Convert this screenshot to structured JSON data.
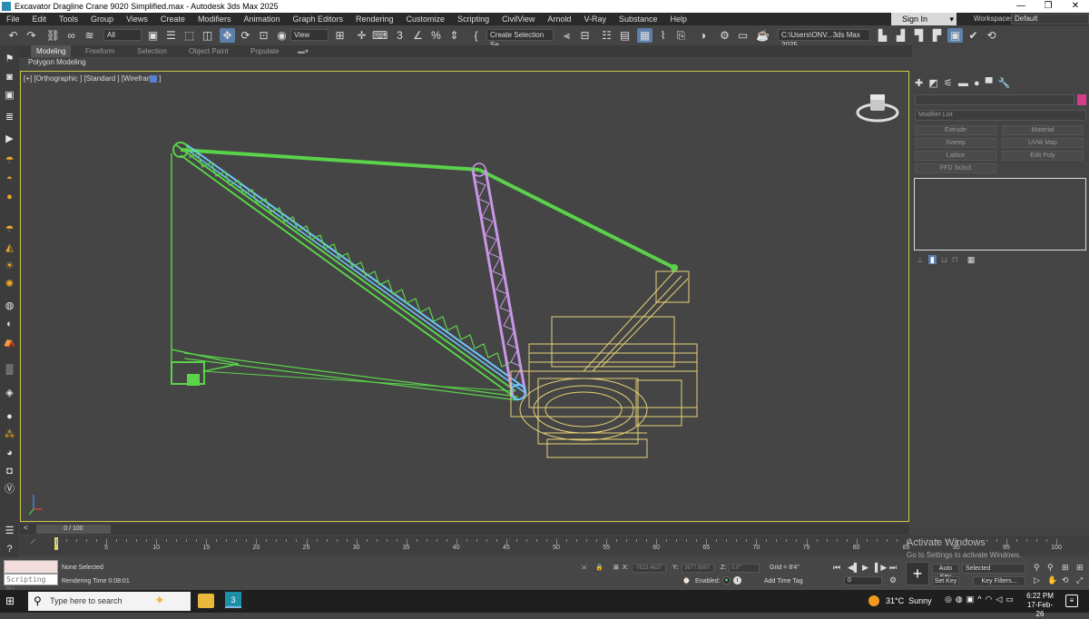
{
  "window": {
    "title": "Excavator Dragline Crane 9020 Simplified.max - Autodesk 3ds Max 2025",
    "min": "—",
    "max": "❐",
    "close": "✕"
  },
  "menu": [
    "File",
    "Edit",
    "Tools",
    "Group",
    "Views",
    "Create",
    "Modifiers",
    "Animation",
    "Graph Editors",
    "Rendering",
    "Customize",
    "Scripting",
    "CivilView",
    "Arnold",
    "V-Ray",
    "Substance",
    "Help"
  ],
  "account": {
    "signin": "Sign In",
    "workspaces_label": "Workspaces:",
    "workspace": "Default"
  },
  "toolbar": {
    "filter": "All",
    "view": "View",
    "selection_set": "Create Selection Se",
    "path": "C:\\Users\\ONV...3ds Max 2025"
  },
  "ribbon": {
    "tabs": [
      "Modeling",
      "Freeform",
      "Selection",
      "Object Paint",
      "Populate"
    ],
    "active": "Modeling",
    "subtitle": "Polygon Modeling"
  },
  "viewport": {
    "label": "[+] [Orthographic ] [Standard ] [Wireframe ]"
  },
  "command_panel": {
    "modifier_list": "Modifier List",
    "buttons": [
      "Extrude",
      "Material",
      "Sweep",
      "UVW Map",
      "Lattice",
      "Edit Poly",
      "FFD 3x3x3"
    ]
  },
  "time": {
    "slider": "0 / 100",
    "ticks": [
      "5",
      "10",
      "15",
      "20",
      "25",
      "30",
      "35",
      "40",
      "45",
      "50",
      "55",
      "60",
      "65",
      "70",
      "75",
      "80",
      "85",
      "90",
      "95",
      "100"
    ]
  },
  "status": {
    "scripting": "Scripting Mi",
    "selection": "None Selected",
    "render_time": "Rendering Time  0:08:01",
    "x_label": "X:",
    "x_val": "-7823.4637",
    "y_label": "Y:",
    "y_val": "3677.9907",
    "z_label": "Z:",
    "z_val": "0.0\"",
    "grid": "Grid = 8'4\"",
    "enabled": "Enabled:",
    "add_time_tag": "Add Time Tag",
    "auto_key": "Auto Key",
    "set_key": "Set Key",
    "selected": "Selected",
    "key_filters": "Key Filters...",
    "frame": "0",
    "activate_title": "Activate Windows",
    "activate_sub": "Go to Settings to activate Windows."
  },
  "taskbar": {
    "search_placeholder": "Type here to search",
    "app_label": "3",
    "temp": "31°C",
    "weather": "Sunny",
    "time": "6:22 PM",
    "date": "17-Feb-26"
  },
  "colors": {
    "accent": "#5d7faa",
    "viewport_border": "#c8c846",
    "boom": "#5ad24a",
    "mast": "#c896e6",
    "base": "#e6d278",
    "cable": "#6ec8ff"
  }
}
